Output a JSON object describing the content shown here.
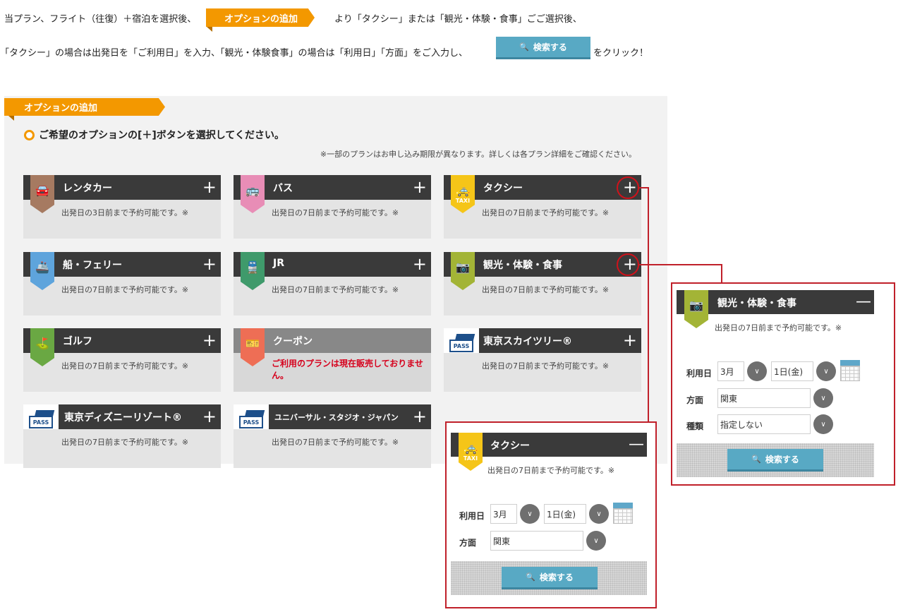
{
  "instructions": {
    "line1_before": "当プラン、フライト（往復）＋宿泊を選択後、",
    "line1_tag": "オプションの追加",
    "line1_after": "より「タクシー」または「観光・体験・食事」ごご選択後、",
    "line2_before": "「タクシー」の場合は出発日を「ご利用日」を入力、「観光・体験食事」の場合は「利用日」「方面」をご入力し、",
    "line2_button": "検索する",
    "line2_after": "をクリック！"
  },
  "panel": {
    "ribbon": "オプションの追加",
    "heading": "ご希望のオプションの[＋]ボタンを選択してください。",
    "note": "※一部のプランはお申し込み期限が異なります。詳しくは各プラン詳細をご確認ください。"
  },
  "cards": [
    {
      "title": "レンタカー",
      "desc": "出発日の3日前まで予約可能です。※",
      "color": "#a67a61",
      "icon": "car-icon"
    },
    {
      "title": "バス",
      "desc": "出発日の7日前まで予約可能です。※",
      "color": "#e88db6",
      "icon": "bus-icon"
    },
    {
      "title": "タクシー",
      "desc": "出発日の7日前まで予約可能です。※",
      "color": "#f5c518",
      "icon": "taxi-icon",
      "badge_sub": "TAXI"
    },
    {
      "title": "船・フェリー",
      "desc": "出発日の7日前まで予約可能です。※",
      "color": "#5ea4dc",
      "icon": "ship-icon"
    },
    {
      "title": "JR",
      "desc": "出発日の7日前まで予約可能です。※",
      "color": "#3f9a6b",
      "icon": "train-icon"
    },
    {
      "title": "観光・体験・食事",
      "desc": "出発日の7日前まで予約可能です。※",
      "color": "#a3b436",
      "icon": "camera-icon"
    },
    {
      "title": "ゴルフ",
      "desc": "出発日の7日前まで予約可能です。※",
      "color": "#6aa843",
      "icon": "golf-icon"
    },
    {
      "title": "クーポン",
      "desc": "ご利用のプランは現在販売しておりません。",
      "color": "#ee6e55",
      "icon": "coupon-icon"
    },
    {
      "title": "東京スカイツリー®",
      "desc": "出発日の7日前まで予約可能です。※",
      "icon": "pass-icon",
      "pass": "PASS"
    },
    {
      "title": "東京ディズニーリゾート®",
      "desc": "出発日の7日前まで予約可能です。※",
      "icon": "pass-icon",
      "pass": "PASS"
    },
    {
      "title": "ユニバーサル・スタジオ・ジャパン",
      "desc": "出発日の7日前まで予約可能です。※",
      "icon": "pass-icon",
      "pass": "PASS"
    }
  ],
  "plus": "+",
  "taxi_popup": {
    "title": "タクシー",
    "minus": "—",
    "desc": "出発日の7日前まで予約可能です。※",
    "date_label": "利用日",
    "month": "3月",
    "day": "1日(金)",
    "area_label": "方面",
    "area": "関東",
    "search": "検索する",
    "badge_sub": "TAXI"
  },
  "sight_popup": {
    "title": "観光・体験・食事",
    "minus": "—",
    "desc": "出発日の7日前まで予約可能です。※",
    "date_label": "利用日",
    "month": "3月",
    "day": "1日(金)",
    "area_label": "方面",
    "area": "関東",
    "type_label": "種類",
    "type": "指定しない",
    "search": "検索する"
  }
}
